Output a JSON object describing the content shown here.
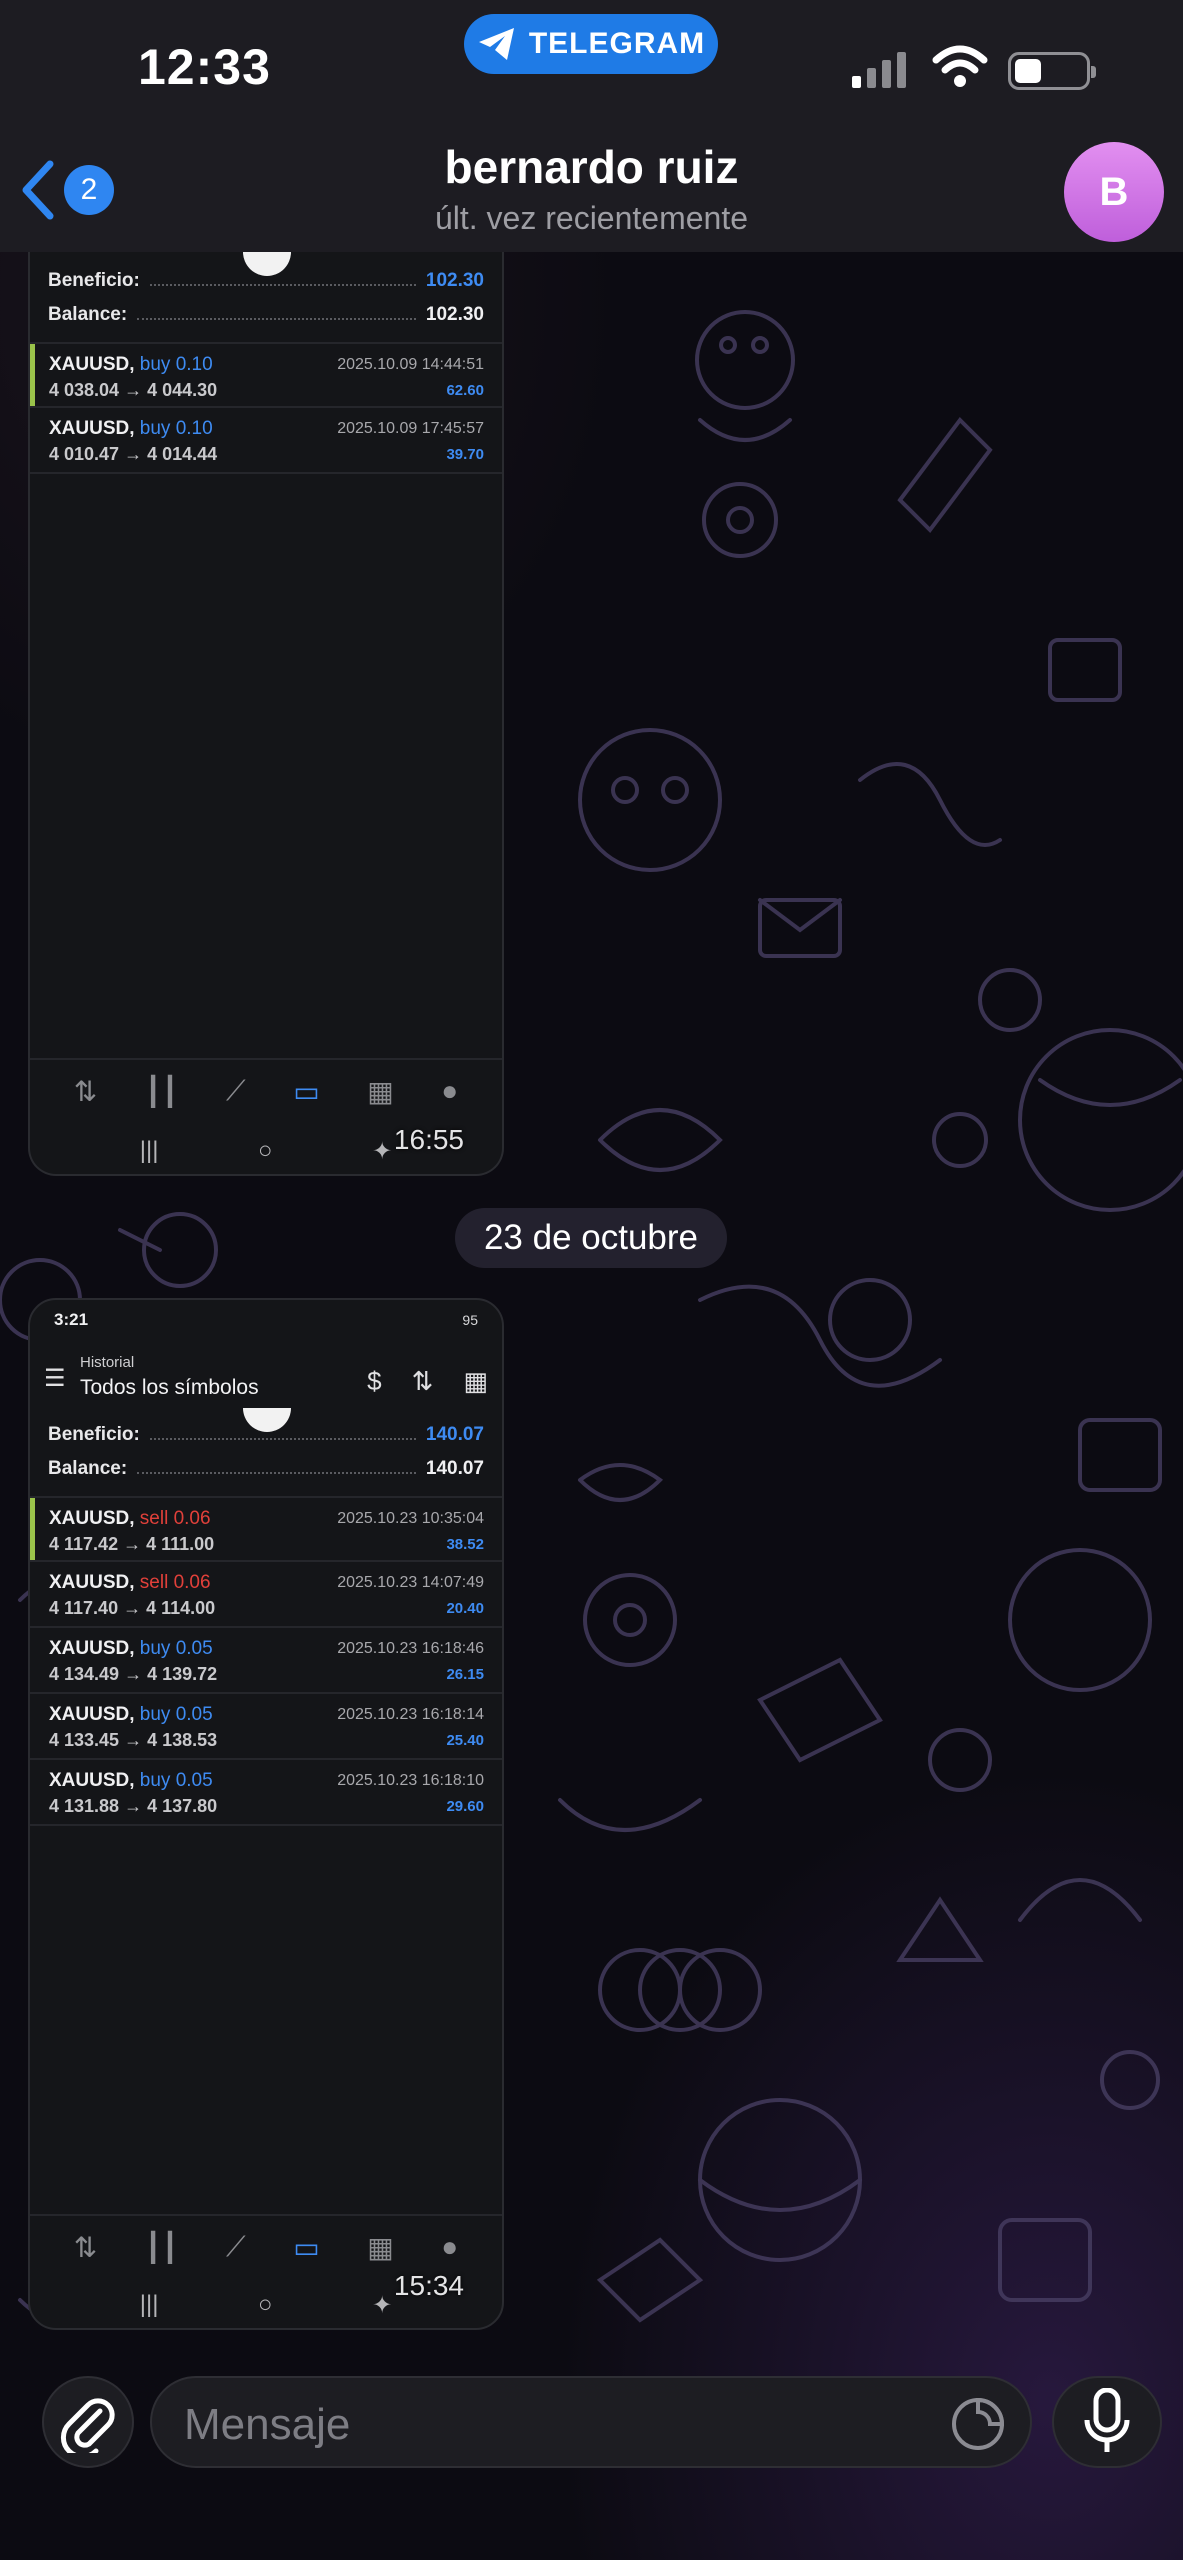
{
  "status_bar": {
    "time": "12:33",
    "app_pill": "TELEGRAM"
  },
  "header": {
    "back_count": "2",
    "title": "bernardo ruiz",
    "subtitle": "últ. vez recientemente",
    "avatar_initial": "B"
  },
  "messages": [
    {
      "beneficio_label": "Beneficio:",
      "beneficio": "102.30",
      "balance_label": "Balance:",
      "balance": "102.30",
      "trades": [
        {
          "symbol": "XAUUSD,",
          "side": "buy 0.10",
          "prices": "4 038.04 → 4 044.30",
          "datetime": "2025.10.09 14:44:51",
          "profit": "62.60"
        },
        {
          "symbol": "XAUUSD,",
          "side": "buy 0.10",
          "prices": "4 010.47 → 4 014.44",
          "datetime": "2025.10.09 17:45:57",
          "profit": "39.70"
        }
      ],
      "time": "16:55"
    },
    {
      "phone_time": "3:21",
      "phone_status": "95",
      "menu_title": "Historial",
      "menu_sub": "Todos los símbolos",
      "beneficio_label": "Beneficio:",
      "beneficio": "140.07",
      "balance_label": "Balance:",
      "balance": "140.07",
      "trades": [
        {
          "symbol": "XAUUSD,",
          "side": "sell 0.06",
          "prices": "4 117.42 → 4 111.00",
          "datetime": "2025.10.23 10:35:04",
          "profit": "38.52"
        },
        {
          "symbol": "XAUUSD,",
          "side": "sell 0.06",
          "prices": "4 117.40 → 4 114.00",
          "datetime": "2025.10.23 14:07:49",
          "profit": "20.40"
        },
        {
          "symbol": "XAUUSD,",
          "side": "buy 0.05",
          "prices": "4 134.49 → 4 139.72",
          "datetime": "2025.10.23 16:18:46",
          "profit": "26.15"
        },
        {
          "symbol": "XAUUSD,",
          "side": "buy 0.05",
          "prices": "4 133.45 → 4 138.53",
          "datetime": "2025.10.23 16:18:14",
          "profit": "25.40"
        },
        {
          "symbol": "XAUUSD,",
          "side": "buy 0.05",
          "prices": "4 131.88 → 4 137.80",
          "datetime": "2025.10.23 16:18:10",
          "profit": "29.60"
        }
      ],
      "time": "15:34"
    }
  ],
  "date_separator": "23 de octubre",
  "composer": {
    "placeholder": "Mensaje"
  },
  "colors": {
    "accent": "#2f86f1",
    "profit_blue": "#3e8bf2",
    "sell_red": "#e0403a",
    "avatar": "#d27ae8"
  }
}
